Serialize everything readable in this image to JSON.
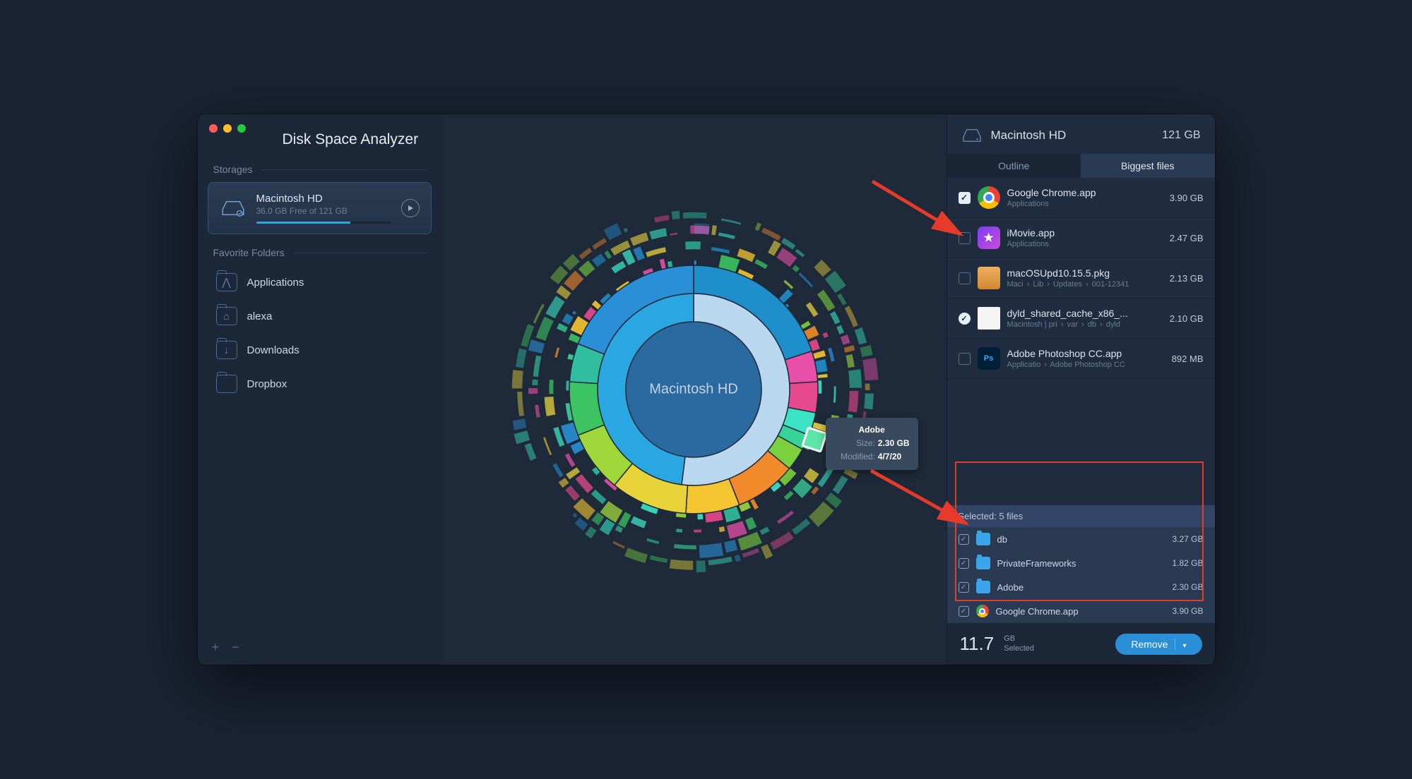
{
  "app": {
    "title": "Disk Space Analyzer"
  },
  "sidebar": {
    "storages_label": "Storages",
    "favorites_label": "Favorite Folders",
    "storage": {
      "name": "Macintosh HD",
      "sub": "36.0 GB Free of 121 GB"
    },
    "favorites": [
      {
        "label": "Applications",
        "glyph": "⋀"
      },
      {
        "label": "alexa",
        "glyph": "⌂"
      },
      {
        "label": "Downloads",
        "glyph": "↓"
      },
      {
        "label": "Dropbox",
        "glyph": ""
      }
    ]
  },
  "center": {
    "label": "Macintosh HD"
  },
  "tooltip": {
    "name": "Adobe",
    "size_label": "Size:",
    "size": "2.30 GB",
    "mod_label": "Modified:",
    "mod": "4/7/20"
  },
  "right": {
    "disk_name": "Macintosh HD",
    "disk_size": "121 GB",
    "tabs": {
      "outline": "Outline",
      "biggest": "Biggest files"
    },
    "files": [
      {
        "checked": true,
        "icon": "chrome",
        "name": "Google Chrome.app",
        "path": "Applications",
        "size": "3.90 GB"
      },
      {
        "checked": false,
        "icon": "imovie",
        "name": "iMovie.app",
        "path": "Applications",
        "size": "2.47 GB"
      },
      {
        "checked": false,
        "icon": "pkg",
        "name": "macOSUpd10.15.5.pkg",
        "path": "Maci › Lib › Updates › 001-12341",
        "size": "2.13 GB"
      },
      {
        "checked": "round",
        "icon": "doc",
        "name": "dyld_shared_cache_x86_...",
        "path": "Macintosh | pri › var › db › dyld",
        "size": "2.10 GB"
      },
      {
        "checked": false,
        "icon": "ps",
        "name": "Adobe Photoshop CC.app",
        "path": "Applicatio › Adobe Photoshop CC",
        "size": "892 MB"
      }
    ],
    "selected_header": "Selected: 5 files",
    "selected": [
      {
        "icon": "folder",
        "name": "db",
        "size": "3.27 GB"
      },
      {
        "icon": "folder",
        "name": "PrivateFrameworks",
        "size": "1.82 GB"
      },
      {
        "icon": "folder",
        "name": "Adobe",
        "size": "2.30 GB"
      },
      {
        "icon": "chrome",
        "name": "Google Chrome.app",
        "size": "3.90 GB"
      }
    ],
    "footer": {
      "total": "11.7",
      "unit": "GB",
      "label": "Selected",
      "remove": "Remove"
    }
  }
}
